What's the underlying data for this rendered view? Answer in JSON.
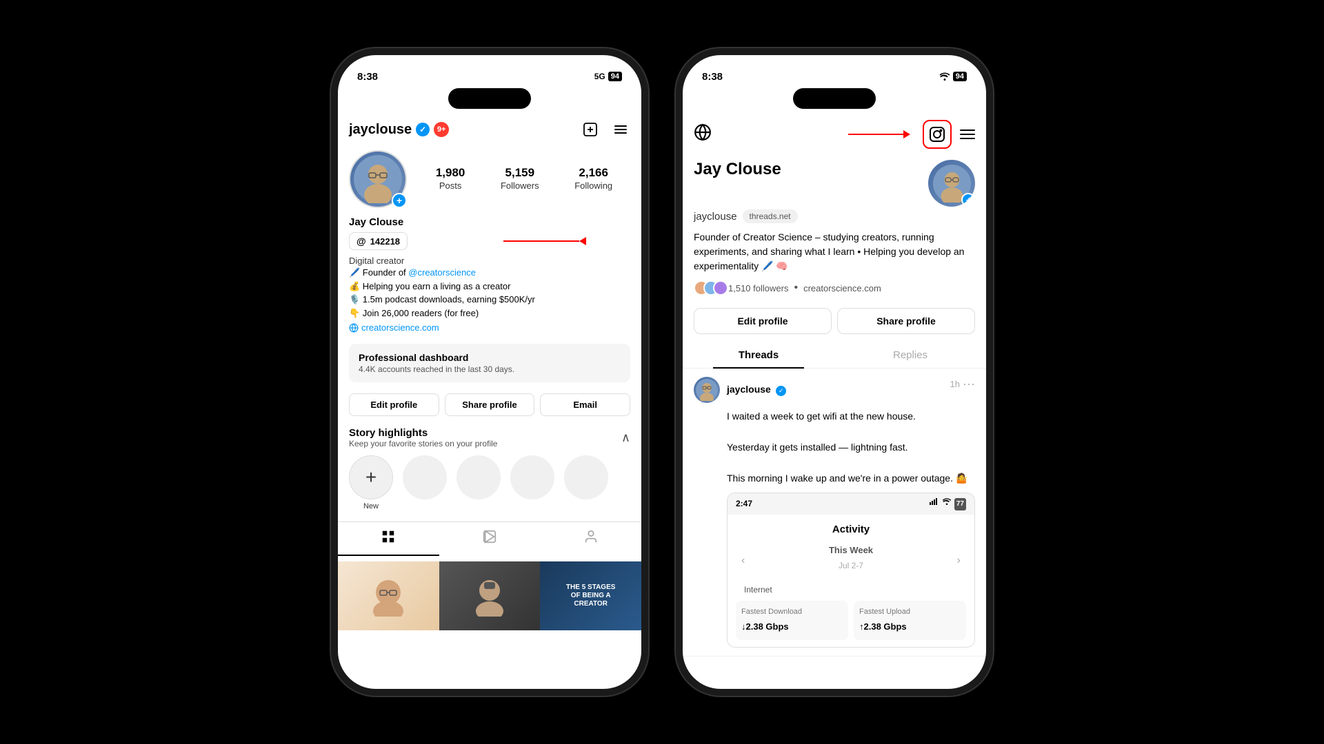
{
  "phone1": {
    "time": "8:38",
    "signal": "5G",
    "battery": "94",
    "username": "jayclouse",
    "verified": "✓",
    "notifications": "9+",
    "stats": {
      "posts": {
        "number": "1,980",
        "label": "Posts"
      },
      "followers": {
        "number": "5,159",
        "label": "Followers"
      },
      "following": {
        "number": "2,166",
        "label": "Following"
      }
    },
    "display_name": "Jay Clouse",
    "threads_count": "142218",
    "bio_type": "Digital creator",
    "bio_lines": [
      "🖊️ Founder of @creatorscience",
      "💰 Helping you earn a living as a creator",
      "🎙️ 1.5m podcast downloads, earning $500K/yr",
      "👇 Join 26,000 readers (for free)"
    ],
    "bio_link": "creatorscience.com",
    "pro_dashboard": {
      "title": "Professional dashboard",
      "subtitle": "4.4K accounts reached in the last 30 days."
    },
    "buttons": {
      "edit": "Edit profile",
      "share": "Share profile",
      "email": "Email"
    },
    "highlights": {
      "title": "Story highlights",
      "subtitle": "Keep your favorite stories on your profile",
      "new_label": "New"
    },
    "grid_tab_icons": [
      "⊞",
      "▶",
      "👤"
    ],
    "thumbnails": [
      {
        "type": "face",
        "emoji": "😐"
      },
      {
        "type": "person",
        "emoji": "🧢"
      },
      {
        "type": "text",
        "content": "THE 5 STAGES OF BEING A CREATOR"
      }
    ]
  },
  "phone2": {
    "time": "8:38",
    "battery": "94",
    "display_name": "Jay Clouse",
    "handle": "jayclouse",
    "threads_net": "threads.net",
    "bio": "Founder of Creator Science – studying creators, running experiments, and sharing what I learn • Helping you develop an experimentality 🖊️ 🧠",
    "followers_count": "1,510 followers",
    "creator_link": "creatorscience.com",
    "buttons": {
      "edit": "Edit profile",
      "share": "Share profile"
    },
    "tabs": {
      "threads": "Threads",
      "replies": "Replies"
    },
    "post": {
      "handle": "jayclouse",
      "time": "1h",
      "lines": [
        "I waited a week to get wifi at the new house.",
        "Yesterday it gets installed — lightning fast.",
        "This morning I wake up and we're in a power outage. 🤷"
      ]
    },
    "nested_phone": {
      "time": "2:47",
      "battery": "77",
      "title": "Activity",
      "subtitle": "This Week",
      "date": "Jul 2-7",
      "internet_label": "Internet",
      "cards": [
        {
          "label": "Fastest Download",
          "value": "↓2.38 Gbps"
        },
        {
          "label": "Fastest Upload",
          "value": "↑2.38 Gbps"
        }
      ]
    }
  },
  "annotations": {
    "threads_arrow_label": "Threads badge annotation",
    "ig_icon_arrow_label": "Instagram icon annotation"
  }
}
